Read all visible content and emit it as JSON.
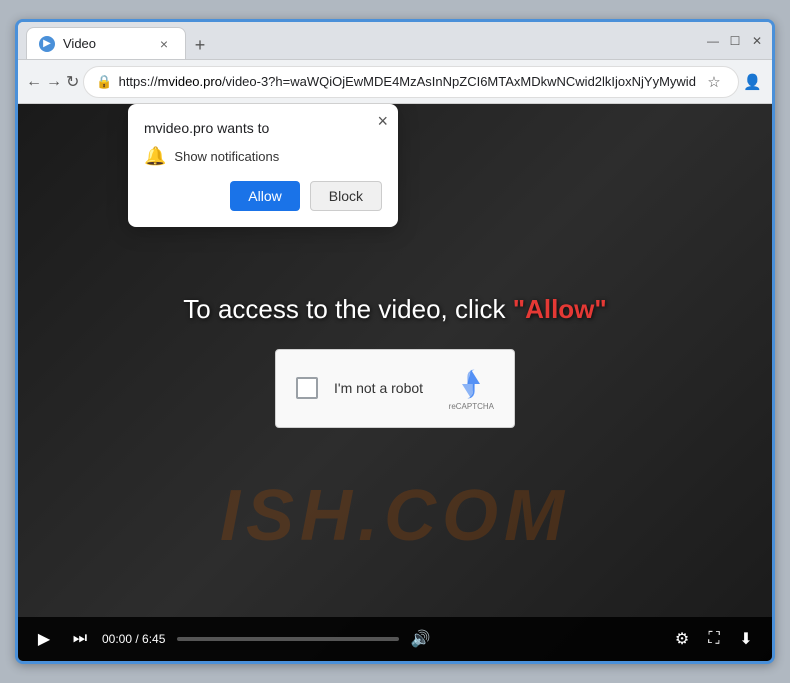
{
  "browser": {
    "tab": {
      "favicon": "▶",
      "title": "Video",
      "close": "×"
    },
    "new_tab_label": "+",
    "window_controls": {
      "minimize": "—",
      "maximize": "☐",
      "close": "✕"
    },
    "nav": {
      "back": "←",
      "forward": "→",
      "refresh": "↻",
      "url": "https://mvideo.pro/video-3?h=waWQiOjEwMDE4MzAsInNpZCI6MTAxMDkwNCwid2lkIjoxNjYyMywid",
      "url_highlight": "mvideo.pro",
      "star": "☆",
      "profile": "👤",
      "menu": "⋮"
    }
  },
  "popup": {
    "title": "mvideo.pro wants to",
    "close": "×",
    "notification_icon": "🔔",
    "notification_text": "Show notifications",
    "allow_label": "Allow",
    "block_label": "Block"
  },
  "video": {
    "main_text_prefix": "To access to the video, click ",
    "main_text_highlight": "\"Allow\"",
    "watermark": "ISH.COM",
    "captcha": {
      "label": "I'm not a robot",
      "logo_text": "reCAPTCHA"
    },
    "controls": {
      "play": "▶",
      "skip": "⏭",
      "time": "00:00 / 6:45",
      "volume": "🔊",
      "settings": "⚙",
      "fullscreen": "⛶",
      "download": "⬇"
    }
  }
}
